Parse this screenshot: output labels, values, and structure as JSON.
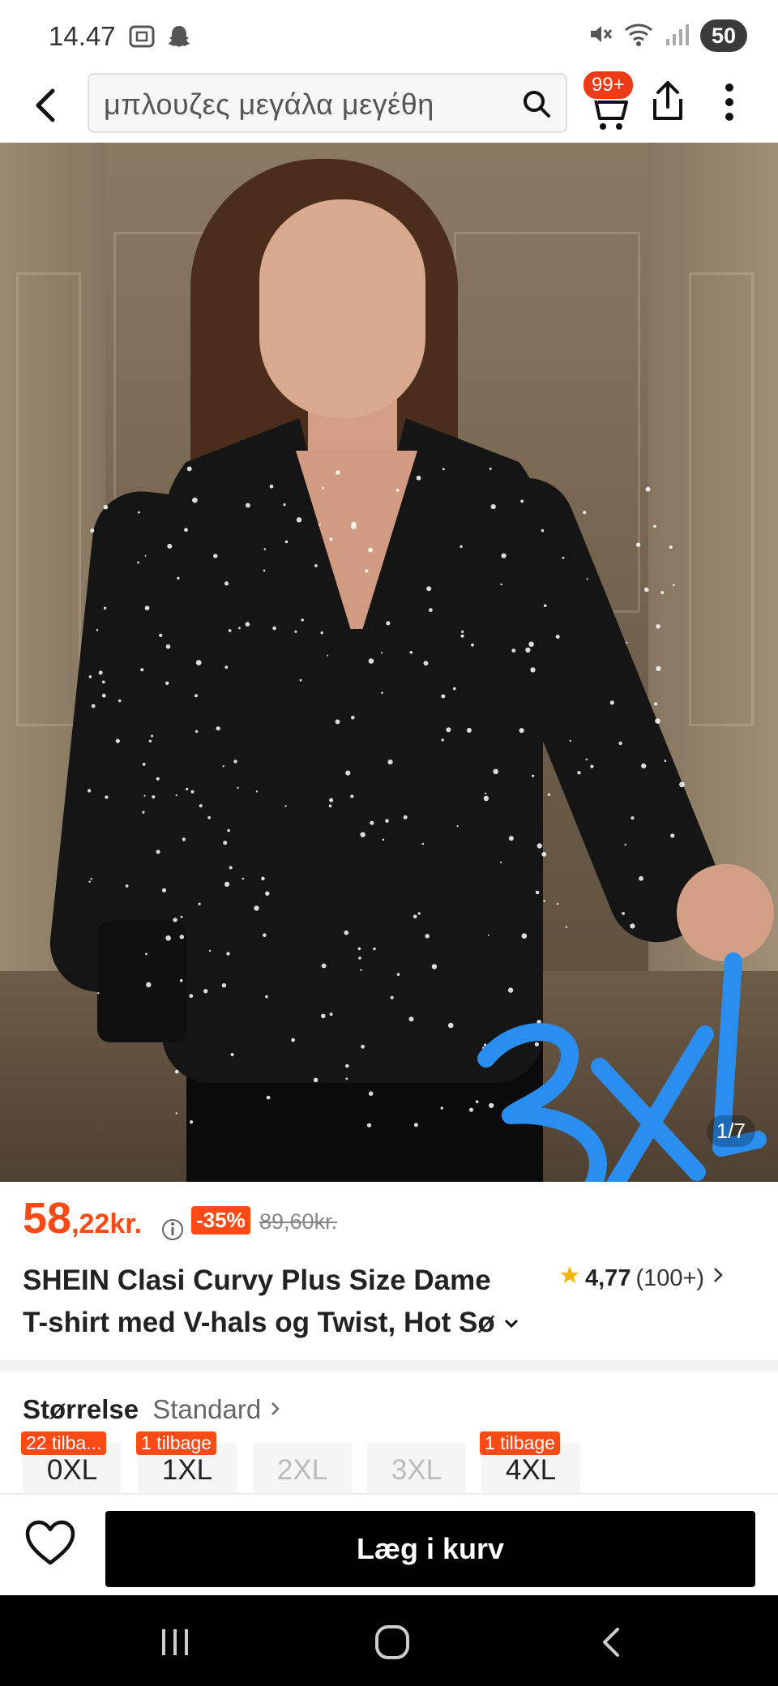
{
  "status_bar": {
    "time": "14.47",
    "battery": "50"
  },
  "search": {
    "query": "μπλουζες μεγάλα μεγέθη",
    "cart_badge": "99+"
  },
  "gallery": {
    "counter": "1/7",
    "handwriting": "3XL"
  },
  "price": {
    "integer": "58",
    "decimal": ",22kr.",
    "discount": "-35%",
    "original": "89,60kr."
  },
  "product": {
    "title_line1": "SHEIN Clasi Curvy Plus Size Dame",
    "title_line2": "T-shirt med V-hals og Twist, Hot Sø",
    "rating": "4,77",
    "review_count": "(100+)"
  },
  "size": {
    "label": "Størrelse",
    "standard": "Standard",
    "options": [
      {
        "name": "0XL",
        "stock": "22 tilba...",
        "available": true
      },
      {
        "name": "1XL",
        "stock": "1 tilbage",
        "available": true
      },
      {
        "name": "2XL",
        "stock": "",
        "available": false
      },
      {
        "name": "3XL",
        "stock": "",
        "available": false
      },
      {
        "name": "4XL",
        "stock": "1 tilbage",
        "available": true
      }
    ]
  },
  "actions": {
    "add_to_cart": "Læg i kurv"
  },
  "colors": {
    "accent": "#fa4a16",
    "cart_button": "#000000",
    "handwriting": "#2a8ef0"
  }
}
